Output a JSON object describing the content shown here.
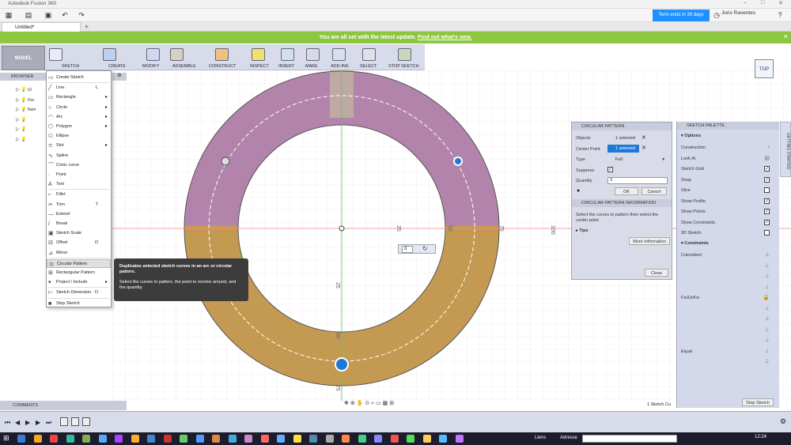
{
  "app": {
    "window_title": "Autodesk Fusion 360",
    "trial_label": "Term ends in 30 days",
    "user_name": "Joris Raventes",
    "help_label": "?"
  },
  "document": {
    "tab_title": "Untitled*"
  },
  "banner": {
    "text": "You are all set with the latest update.",
    "link": "Find out what's new."
  },
  "toolbar": {
    "workspace": "MODEL",
    "groups": [
      "SKETCH",
      "CREATE",
      "MODIFY",
      "ASSEMBLE",
      "CONSTRUCT",
      "INSPECT",
      "INSERT",
      "MAKE",
      "ADD-INS",
      "SELECT",
      "STOP SKETCH"
    ]
  },
  "browser": {
    "header": "BROWSER",
    "items": [
      "(U",
      "Doc",
      "Nam",
      "",
      "",
      ""
    ]
  },
  "sketch_menu": {
    "items": [
      {
        "label": "Create Sketch",
        "shortcut": "",
        "arrow": false
      },
      {
        "label": "Line",
        "shortcut": "L",
        "arrow": false
      },
      {
        "label": "Rectangle",
        "shortcut": "",
        "arrow": true
      },
      {
        "label": "Circle",
        "shortcut": "",
        "arrow": true
      },
      {
        "label": "Arc",
        "shortcut": "",
        "arrow": true
      },
      {
        "label": "Polygon",
        "shortcut": "",
        "arrow": true
      },
      {
        "label": "Ellipse",
        "shortcut": "",
        "arrow": false
      },
      {
        "label": "Slot",
        "shortcut": "",
        "arrow": true
      },
      {
        "label": "Spline",
        "shortcut": "",
        "arrow": false
      },
      {
        "label": "Conic curve",
        "shortcut": "",
        "arrow": false
      },
      {
        "label": "Point",
        "shortcut": "",
        "arrow": false
      },
      {
        "label": "Text",
        "shortcut": "",
        "arrow": false
      },
      {
        "label": "Fillet",
        "shortcut": "",
        "arrow": false
      },
      {
        "label": "Trim",
        "shortcut": "T",
        "arrow": false
      },
      {
        "label": "Extend",
        "shortcut": "",
        "arrow": false
      },
      {
        "label": "Break",
        "shortcut": "",
        "arrow": false
      },
      {
        "label": "Sketch Scale",
        "shortcut": "",
        "arrow": false
      },
      {
        "label": "Offset",
        "shortcut": "O",
        "arrow": false
      },
      {
        "label": "Mirror",
        "shortcut": "",
        "arrow": false
      },
      {
        "label": "Circular Pattern",
        "shortcut": "",
        "arrow": false
      },
      {
        "label": "Rectangular Pattern",
        "shortcut": "",
        "arrow": false
      },
      {
        "label": "Project / Include",
        "shortcut": "",
        "arrow": true
      },
      {
        "label": "Sketch Dimension",
        "shortcut": "D",
        "arrow": false
      },
      {
        "label": "Stop Sketch",
        "shortcut": "",
        "arrow": false
      }
    ]
  },
  "tooltip": {
    "title": "Duplicates selected sketch curves in an arc or circular pattern.",
    "body": "Select the curves to pattern, the point to revolve around, and the quantity."
  },
  "circular_pattern": {
    "title": "CIRCULAR PATTERN",
    "objects_label": "Objects",
    "objects_value": "1 selected",
    "center_label": "Center Point",
    "center_value": "1 selected",
    "type_label": "Type",
    "type_value": "Full",
    "suppress_label": "Suppress",
    "quantity_label": "Quantity",
    "quantity_value": "3",
    "ok_label": "OK",
    "cancel_label": "Cancel",
    "info_title": "CIRCULAR PATTERN INFORMATION",
    "info_text": "Select the curves to pattern then select the center point",
    "tips_label": "Tips",
    "more_info_label": "More Information",
    "close_label": "Close"
  },
  "sketch_palette": {
    "title": "SKETCH PALETTE",
    "options_header": "Options",
    "options": [
      {
        "label": "Construction",
        "checked": null
      },
      {
        "label": "Look At",
        "checked": null
      },
      {
        "label": "Sketch Grid",
        "checked": true
      },
      {
        "label": "Snap",
        "checked": true
      },
      {
        "label": "Slice",
        "checked": false
      },
      {
        "label": "Show Profile",
        "checked": true
      },
      {
        "label": "Show Points",
        "checked": true
      },
      {
        "label": "Show Constraints",
        "checked": true
      },
      {
        "label": "3D Sketch",
        "checked": false
      }
    ],
    "constraints_header": "Constraints",
    "constraints": [
      "Coincident",
      "",
      "",
      "",
      "Fix/UnFix",
      "",
      "",
      "",
      "",
      "Equal",
      ""
    ],
    "stop_label": "Stop Sketch"
  },
  "getting_started": "GETTING STARTED",
  "canvas": {
    "dims": [
      "25",
      "50",
      "75",
      "100",
      "25",
      "50",
      "75"
    ],
    "quantity_popup": "3"
  },
  "viewcube": "TOP",
  "comments": {
    "label": "COMMENTS"
  },
  "status": "1 Sketch Cu",
  "taskbar": {
    "liens": "Liens",
    "adresse": "Adresse",
    "clock": "12:24"
  },
  "colors": {
    "banner": "#8dc63f",
    "accent_blue": "#1e78d7",
    "profile_purple": "#a56e9e",
    "profile_gold": "#c49a52"
  }
}
